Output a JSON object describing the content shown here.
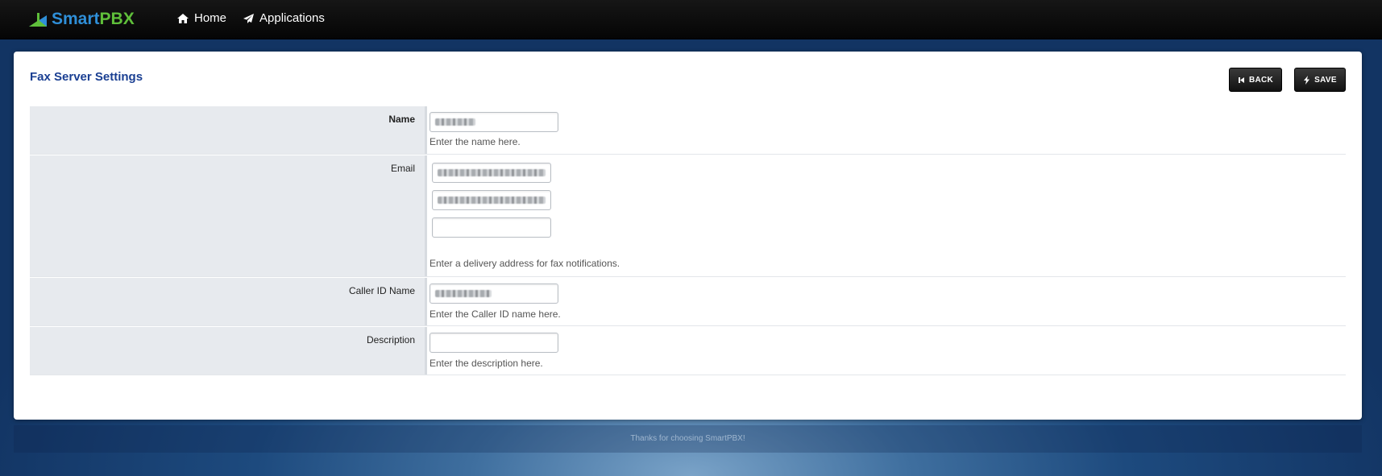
{
  "header": {
    "logo": {
      "smart": "Smart",
      "pbx": "PBX",
      "icon": "smartpbx-logo-icon"
    },
    "nav": [
      {
        "label": "Home",
        "icon": "home-icon"
      },
      {
        "label": "Applications",
        "icon": "paper-plane-icon"
      }
    ]
  },
  "page": {
    "title": "Fax Server Settings",
    "buttons": {
      "back": "BACK",
      "save": "SAVE"
    }
  },
  "form": {
    "name": {
      "label": "Name",
      "help": "Enter the name here."
    },
    "email": {
      "label": "Email",
      "help": "Enter a delivery address for fax notifications.",
      "third_value": ""
    },
    "caller_id": {
      "label": "Caller ID Name",
      "help": "Enter the Caller ID name here."
    },
    "description": {
      "label": "Description",
      "help": "Enter the description here.",
      "value": ""
    }
  },
  "footer": {
    "text": "Thanks for choosing SmartPBX!"
  },
  "colors": {
    "title": "#1a3f92",
    "logo_smart": "#2f8fd8",
    "logo_pbx": "#5fbf3a"
  }
}
